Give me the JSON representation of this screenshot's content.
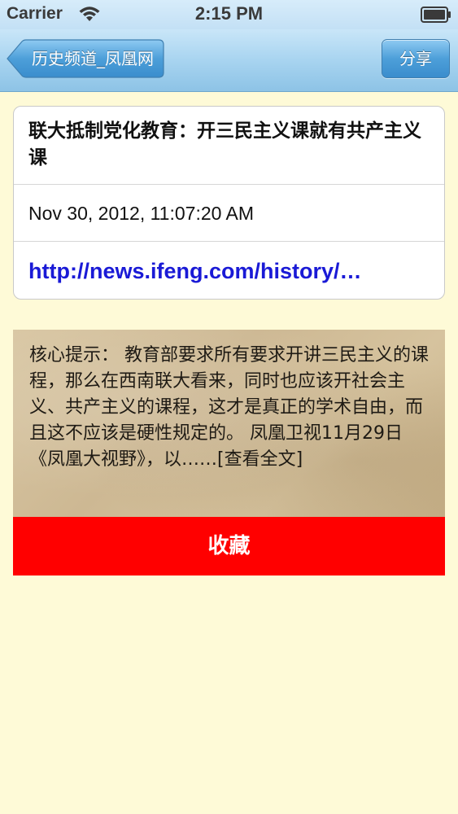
{
  "status_bar": {
    "carrier": "Carrier",
    "time": "2:15 PM"
  },
  "nav": {
    "back_label": "历史频道_凤凰网",
    "share_label": "分享"
  },
  "article": {
    "title": "联大抵制党化教育：开三民主义课就有共产主义课",
    "date": "Nov 30, 2012, 11:07:20 AM",
    "url": "http://news.ifeng.com/history/…"
  },
  "summary": {
    "text": "核心提示： 教育部要求所有要求开讲三民主义的课程，那么在西南联大看来，同时也应该开社会主义、共产主义的课程，这才是真正的学术自由，而且这不应该是硬性规定的。 凤凰卫视11月29日《凤凰大视野》，以……[查看全文]"
  },
  "actions": {
    "collect_label": "收藏"
  },
  "colors": {
    "background": "#fefad7",
    "collect_button": "#ff0000",
    "link": "#1a1ad6"
  }
}
